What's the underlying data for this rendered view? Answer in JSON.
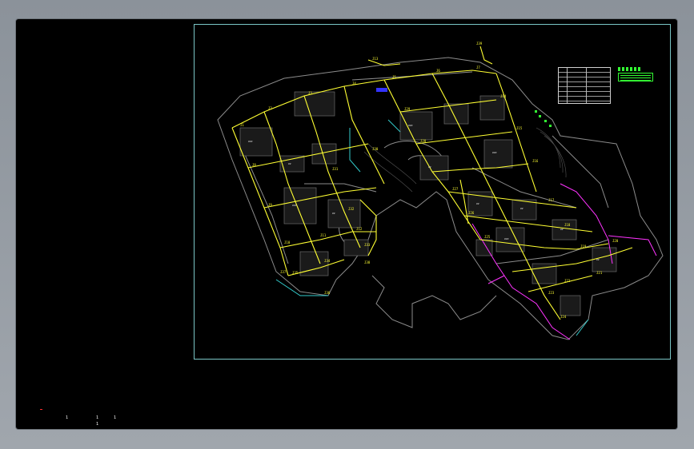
{
  "window": {
    "app": "CAD drawing viewer"
  },
  "legend": {
    "title": "",
    "rows": 7
  },
  "status_marks": {
    "mark_a": "1",
    "mark_b": "1",
    "mark_c": "1",
    "mark_d": "1"
  },
  "colors": {
    "background": "#000000",
    "frame": "#8d939b",
    "pipes": "#ffff33",
    "roads": "#8c8c8c",
    "border": "#7ac6c6",
    "accent_magenta": "#ff33ff",
    "accent_green": "#33ff33",
    "accent_cyan": "#33cccc",
    "accent_blue": "#3333ff"
  }
}
